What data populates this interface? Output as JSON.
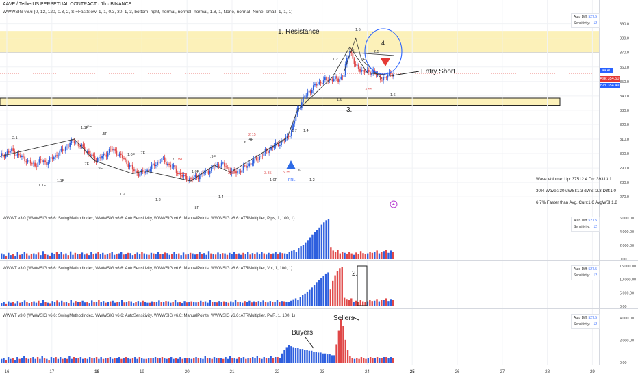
{
  "header": {
    "title": "AAVE / TetherUS PERPETUAL CONTRACT · 1h · BINANCE",
    "study": "WWWSIG v6.6 (0, 12, 120, 0.3, 2, SI+FastSlow, 1, 1, 0.3, 30, 1, 3, bottom_right, normal, normal, normal, 1.8, 1, None, normal, None, small, 1, 1, 1)"
  },
  "panels": [
    {
      "label": "WWWT v3.0 (WWWSIG v6.6: SwingMethodIndex, WWWSIG v6.6: AutoSensitivity, WWWSIG v6.6: ManualPoints, WWWSIG v6.6: ATRMultiplier, Pips, 1, 100, 1)"
    },
    {
      "label": "WWWT v3.0 (WWWSIG v6.6: SwingMethodIndex, WWWSIG v6.6: AutoSensitivity, WWWSIG v6.6: ManualPoints, WWWSIG v6.6: ATRMultiplier, Vol, 1, 100, 1)"
    },
    {
      "label": "WWWT v3.0 (WWWSIG v6.6: SwingMethodIndex, WWWSIG v6.6: AutoSensitivity, WWWSIG v6.6: ManualPoints, WWWSIG v6.6: ATRMultiplier, PVR, 1, 100, 1)"
    }
  ],
  "badge": {
    "auto_diff_label": "Auto Diff:",
    "auto_diff_value": "527.5",
    "sensitivity_label": "Sensitivity:",
    "sensitivity_value": "12"
  },
  "stats": {
    "line1": "Wave Volume: Up: 37512.4 Dn: 39313.1",
    "line2": "30% Waves:30 uWSI:1.3 dWSI:2.3 Diff:1.0",
    "line3": "6.7% Faster than Avg. Curr:1.6 AvgWSI:1.8"
  },
  "price_tags": {
    "last": "44.40",
    "ask_label": "Ask",
    "ask": "354.50",
    "bid_label": "Bid",
    "bid": "354.49"
  },
  "annotations": {
    "resistance": "1. Resistance",
    "entry_short": "Entry Short",
    "three": "3.",
    "two": "2.",
    "four": "4.",
    "buyers": "Buyers",
    "sellers": "Sellers"
  },
  "colors": {
    "up": "#2e5fde",
    "down": "#e04848",
    "zone": "#fcf1b9",
    "wave": "#3a3a3a",
    "accent": "#2962ff"
  },
  "chart_data": {
    "type": "bar",
    "main": {
      "type": "candlestick",
      "x_ticks": [
        "16",
        "17",
        "18",
        "19",
        "20",
        "21",
        "22",
        "23",
        "24",
        "25",
        "26",
        "27",
        "28",
        "29"
      ],
      "y_ticks": [
        270,
        280,
        290,
        300,
        310,
        320,
        330,
        340,
        350,
        360,
        370,
        380,
        390
      ],
      "ylim": [
        262,
        396
      ],
      "resistance_zone": [
        370,
        385
      ],
      "support_zone": [
        333.5,
        338.5
      ],
      "close_path": [
        [
          0,
          298
        ],
        [
          4,
          300
        ],
        [
          8,
          302
        ],
        [
          12,
          299
        ],
        [
          16,
          297
        ],
        [
          20,
          294
        ],
        [
          24,
          292
        ],
        [
          28,
          295
        ],
        [
          32,
          294
        ],
        [
          36,
          297
        ],
        [
          40,
          300
        ],
        [
          44,
          303
        ],
        [
          48,
          307
        ],
        [
          51,
          309
        ],
        [
          54,
          306
        ],
        [
          58,
          303
        ],
        [
          62,
          299
        ],
        [
          65,
          296
        ],
        [
          69,
          297
        ],
        [
          73,
          300
        ],
        [
          76,
          303
        ],
        [
          80,
          301
        ],
        [
          84,
          297
        ],
        [
          87,
          294
        ],
        [
          91,
          289
        ],
        [
          95,
          286
        ],
        [
          99,
          287
        ],
        [
          103,
          290
        ],
        [
          107,
          293
        ],
        [
          111,
          296
        ],
        [
          115,
          293
        ],
        [
          119,
          290
        ],
        [
          123,
          286
        ],
        [
          127,
          283
        ],
        [
          131,
          282
        ],
        [
          135,
          284
        ],
        [
          139,
          286
        ],
        [
          143,
          288
        ],
        [
          147,
          291
        ],
        [
          151,
          293
        ],
        [
          155,
          291
        ],
        [
          158,
          288
        ],
        [
          162,
          287
        ],
        [
          166,
          289
        ],
        [
          170,
          292
        ],
        [
          174,
          295
        ],
        [
          177,
          297
        ],
        [
          181,
          300
        ],
        [
          185,
          303
        ],
        [
          189,
          306
        ],
        [
          193,
          308
        ],
        [
          197,
          311
        ],
        [
          200,
          316
        ],
        [
          204,
          330
        ],
        [
          208,
          338
        ],
        [
          212,
          343
        ],
        [
          216,
          347
        ],
        [
          220,
          350
        ],
        [
          224,
          351
        ],
        [
          228,
          352
        ],
        [
          232,
          351
        ],
        [
          236,
          355
        ],
        [
          238,
          365
        ],
        [
          240,
          372
        ],
        [
          242,
          366
        ],
        [
          244,
          360
        ],
        [
          248,
          358
        ],
        [
          252,
          356
        ],
        [
          256,
          357
        ],
        [
          260,
          353
        ],
        [
          264,
          352
        ],
        [
          268,
          356
        ],
        [
          270,
          355
        ]
      ],
      "wave_labels": [
        "2.1",
        "1.1F",
        "1.1F",
        "1.1F",
        ".6F",
        ".5F",
        ".7F",
        ".9F",
        "1.0F",
        ".7F",
        "1.7",
        "1.0F",
        ".9F",
        "1.6",
        ".4F",
        ".6F",
        "1.7",
        "1.4",
        "1.2",
        ".6F",
        "1.6",
        "1.5",
        "1.6",
        "1.2",
        "1.3",
        ".8F",
        "1.4",
        "1.2",
        "1.0F",
        "1.6",
        ".6",
        "2.5"
      ],
      "wave_labels_red": [
        "2.15",
        "2.55",
        "3.55",
        "5.35",
        "3.35"
      ],
      "markers": [
        "FRL",
        "WU"
      ]
    },
    "subpanels": [
      {
        "name": "Pips",
        "y_ticks": [
          "6,000.00",
          "4,000.00",
          "2,000.00",
          "0.00"
        ],
        "ylim": [
          0,
          6500
        ],
        "values": [
          2,
          1.6,
          -1.2,
          2.2,
          1.4,
          -1.8,
          1.2,
          2.4,
          -1.5,
          1.8,
          2.6,
          -2.0,
          1.3,
          -1.7,
          2.0,
          1.6,
          -2.3,
          1.4,
          2.8,
          -1.9,
          1.5,
          -1.2,
          2.2,
          1.8,
          -2.5,
          1.7,
          2.4,
          -1.6,
          2.0,
          -1.4,
          2.7,
          1.5,
          -2.2,
          1.9,
          -1.7,
          2.3,
          1.6,
          -2.0,
          1.4,
          2.5,
          -1.8,
          2.0,
          -2.6,
          1.7,
          2.2,
          -1.5,
          1.9,
          -2.1,
          2.4,
          1.5,
          -1.8,
          2.0,
          2.6,
          -1.6,
          1.8,
          -2.2,
          2.1,
          1.4,
          -1.9,
          2.3,
          1.7,
          -2.4,
          2.0,
          1.6,
          -1.5,
          2.2,
          -2.0,
          1.8,
          2.5,
          -1.7,
          1.9,
          -2.3,
          2.1,
          1.5,
          -1.8,
          2.6,
          1.7,
          -2.0,
          1.4,
          2.3,
          -1.6,
          1.9,
          -2.2,
          2.0,
          1.6,
          -1.9,
          2.4,
          -1.7,
          2.1,
          1.5,
          2.8,
          -2.0,
          1.9,
          -1.6,
          2.3,
          1.8,
          -2.1,
          2.0,
          -1.5,
          2.2,
          1.7,
          2.6,
          -1.8,
          2.0,
          1.5,
          -2.2,
          1.9,
          2.4,
          -1.6,
          2.1,
          -1.9,
          2.3,
          1.8,
          2.5,
          -2.0,
          1.6,
          2.2,
          -1.7,
          2.0,
          2.6,
          -1.8,
          2.3,
          -2.1,
          2.0,
          1.7,
          2.4,
          2.9,
          3.2,
          2.6,
          3.8,
          4.5,
          5.0,
          5.8,
          6.6,
          7.5,
          8.4,
          9.3,
          10.2,
          11.0,
          12.0,
          12.8,
          13.5,
          14.0,
          -4.0,
          -3.0,
          -2.6,
          -3.2,
          -2.0,
          -2.4,
          2.2,
          -1.8,
          -2.6,
          -2.0,
          1.5,
          -2.3,
          -1.7,
          -2.8,
          -2.1,
          -1.9,
          2.0,
          -2.6,
          -2.2,
          2.4,
          -3.0,
          2.0,
          -2.5,
          2.8,
          -3.2,
          2.2,
          3.0,
          -2.6
        ]
      },
      {
        "name": "Vol",
        "y_ticks": [
          "15,000.00",
          "10,000.00",
          "5,000.00",
          "0.00"
        ],
        "ylim": [
          0,
          15500
        ],
        "values": [
          1.2,
          1.5,
          -1.0,
          1.8,
          1.3,
          -1.6,
          1.1,
          1.9,
          -1.3,
          1.5,
          2.1,
          -1.7,
          1.2,
          -1.5,
          1.8,
          1.3,
          -2.0,
          1.2,
          2.3,
          -1.6,
          1.3,
          -1.1,
          1.9,
          1.5,
          -2.1,
          1.4,
          2.0,
          -1.4,
          1.7,
          -1.2,
          2.2,
          1.3,
          -1.9,
          1.6,
          -1.5,
          2.0,
          1.4,
          -1.7,
          1.2,
          2.1,
          -1.6,
          1.7,
          -2.2,
          1.5,
          1.9,
          -1.3,
          1.6,
          -1.8,
          2.0,
          1.3,
          -1.5,
          1.7,
          2.2,
          -1.4,
          1.5,
          -1.9,
          1.8,
          1.2,
          -1.6,
          1.9,
          1.4,
          -2.0,
          1.7,
          1.3,
          -1.3,
          1.8,
          -1.7,
          1.5,
          2.1,
          -1.5,
          1.6,
          -1.9,
          1.8,
          1.3,
          -1.5,
          2.2,
          1.4,
          -1.7,
          1.2,
          1.9,
          -1.4,
          1.6,
          -1.8,
          1.7,
          1.4,
          -1.6,
          2.0,
          -1.5,
          1.8,
          1.3,
          2.4,
          -1.7,
          1.6,
          -1.4,
          1.9,
          1.5,
          -1.8,
          1.7,
          -1.3,
          1.8,
          1.4,
          2.2,
          -1.6,
          1.7,
          1.3,
          -1.9,
          1.6,
          2.0,
          -1.4,
          1.8,
          -1.6,
          1.9,
          1.5,
          2.1,
          -1.7,
          1.4,
          1.9,
          -1.5,
          1.7,
          2.2,
          -1.6,
          1.9,
          -1.8,
          1.7,
          1.5,
          2.0,
          2.5,
          2.8,
          2.3,
          3.2,
          3.9,
          4.4,
          5.1,
          5.9,
          6.7,
          7.5,
          8.4,
          9.2,
          10.0,
          10.8,
          11.4,
          12.0,
          -6.0,
          -9.0,
          -11.0,
          -12.5,
          -13.5,
          -14.0,
          -3.0,
          -2.6,
          -2.2,
          -2.8,
          1.5,
          -2.0,
          -1.6,
          -2.4,
          -1.8,
          -1.6,
          1.8,
          -2.2,
          -1.9,
          2.0,
          -2.6,
          1.8,
          -2.2,
          2.4,
          -2.8,
          1.9,
          2.6,
          -2.3
        ]
      },
      {
        "name": "PVR",
        "y_ticks": [
          "4,000.00",
          "2,000.00",
          "0.00"
        ],
        "ylim": [
          0,
          5400
        ],
        "values": [
          0.4,
          0.5,
          -0.3,
          0.6,
          0.4,
          -0.5,
          0.3,
          0.6,
          -0.4,
          0.5,
          0.7,
          -0.5,
          0.4,
          -0.5,
          0.6,
          0.4,
          -0.6,
          0.4,
          0.7,
          -0.5,
          0.4,
          -0.3,
          0.6,
          0.5,
          -0.6,
          0.4,
          0.6,
          -0.4,
          0.5,
          -0.4,
          0.7,
          0.4,
          -0.6,
          0.5,
          -0.5,
          0.6,
          0.4,
          -0.5,
          0.4,
          0.6,
          -0.5,
          0.5,
          -0.6,
          0.4,
          0.6,
          -0.4,
          0.5,
          -0.5,
          0.6,
          0.4,
          -0.5,
          0.5,
          0.6,
          -0.4,
          0.5,
          -0.6,
          0.5,
          0.4,
          -0.5,
          0.6,
          0.4,
          -0.6,
          0.5,
          0.4,
          -0.4,
          0.5,
          -0.5,
          0.5,
          0.6,
          -0.5,
          0.5,
          -0.6,
          0.5,
          0.4,
          -0.5,
          0.6,
          0.4,
          -0.5,
          0.4,
          0.6,
          -0.4,
          0.5,
          -0.5,
          0.5,
          0.4,
          -0.5,
          0.6,
          -0.5,
          0.5,
          0.4,
          0.7,
          -0.5,
          0.5,
          -0.4,
          0.6,
          0.5,
          -0.5,
          0.5,
          -0.4,
          0.6,
          0.4,
          0.7,
          -0.5,
          0.5,
          0.4,
          -0.6,
          0.5,
          0.6,
          -0.4,
          0.5,
          -0.5,
          0.6,
          0.5,
          0.7,
          -0.5,
          0.4,
          0.6,
          -0.5,
          0.5,
          0.7,
          -0.5,
          0.6,
          -0.6,
          0.5,
          1.0,
          1.4,
          1.7,
          1.9,
          1.8,
          1.7,
          1.6,
          1.6,
          1.5,
          1.5,
          1.4,
          1.4,
          1.3,
          1.3,
          1.2,
          1.2,
          1.1,
          1.1,
          1.0,
          1.0,
          0.9,
          0.9,
          0.8,
          0.8,
          -2.0,
          -3.5,
          -4.8,
          -4.0,
          -2.5,
          -1.4,
          -0.7,
          -0.5,
          0.4,
          -0.5,
          -0.4,
          -0.6,
          -0.5,
          -0.4,
          0.5,
          -0.6,
          -0.5,
          0.5,
          -0.6,
          0.5,
          -0.5,
          0.6,
          -0.6,
          0.5,
          0.6,
          -0.5
        ]
      }
    ]
  }
}
